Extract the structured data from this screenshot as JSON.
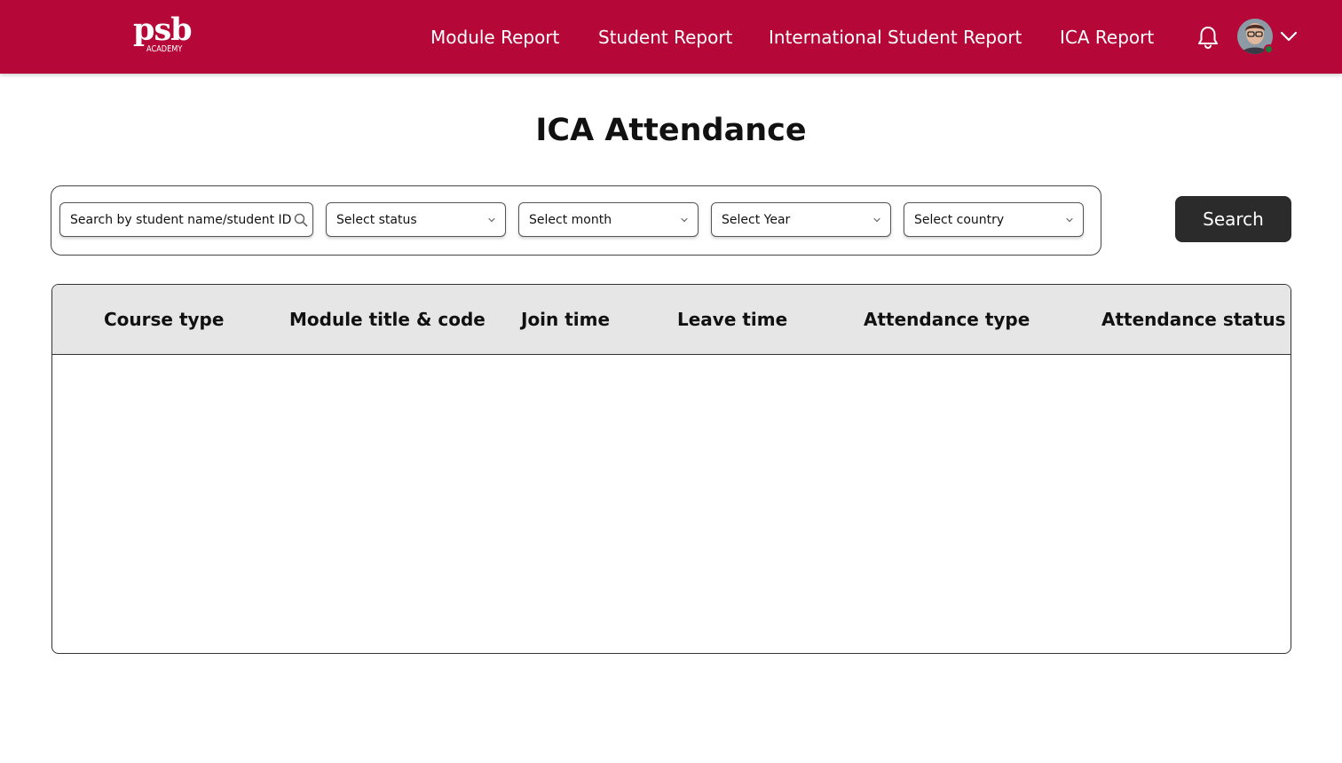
{
  "brand": {
    "color": "#b50838",
    "logo_main": "psb",
    "logo_sub": "ACADEMY"
  },
  "nav": {
    "items": [
      {
        "label": "Module Report"
      },
      {
        "label": "Student Report"
      },
      {
        "label": "International Student Report"
      },
      {
        "label": "ICA Report"
      }
    ],
    "notification_icon": "bell-icon",
    "profile_icon": "avatar",
    "profile_menu_icon": "chevron-down-icon"
  },
  "page": {
    "title": "ICA Attendance"
  },
  "filters": {
    "search_placeholder": "Search by student name/student  ID",
    "status": "Select  status",
    "month": "Select month",
    "year": "Select Year",
    "country": "Select country",
    "search_button": "Search"
  },
  "table": {
    "columns": [
      "Course type",
      "Module title & code",
      "Join time",
      "Leave time",
      "Attendance type",
      "Attendance status"
    ],
    "rows": []
  }
}
